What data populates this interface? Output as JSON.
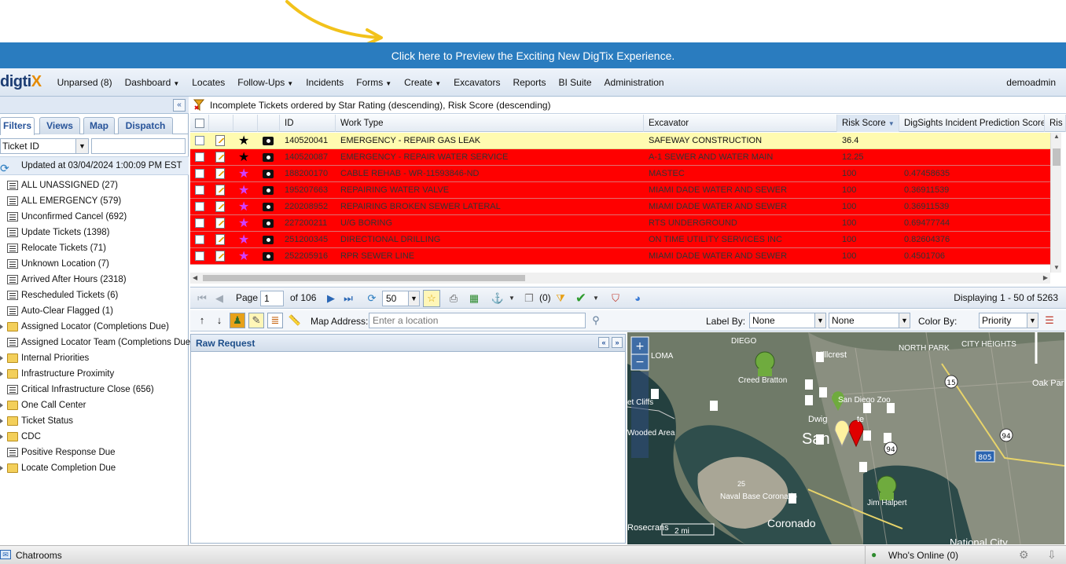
{
  "banner": {
    "text": "Click here to Preview the Exciting New DigTix Experience."
  },
  "nav": {
    "logo": "digtix",
    "items": [
      {
        "label": "Unparsed (8)",
        "caret": false
      },
      {
        "label": "Dashboard",
        "caret": true
      },
      {
        "label": "Locates",
        "caret": false
      },
      {
        "label": "Follow-Ups",
        "caret": true
      },
      {
        "label": "Incidents",
        "caret": false
      },
      {
        "label": "Forms",
        "caret": true
      },
      {
        "label": "Create",
        "caret": true
      },
      {
        "label": "Excavators",
        "caret": false
      },
      {
        "label": "Reports",
        "caret": false
      },
      {
        "label": "BI Suite",
        "caret": false
      },
      {
        "label": "Administration",
        "caret": false
      }
    ],
    "user": "demoadmin"
  },
  "sidebar": {
    "tabs": [
      "Filters",
      "Views",
      "Map",
      "Dispatch"
    ],
    "filter_select": "Ticket ID",
    "updated": "Updated at 03/04/2024 1:00:09 PM EST",
    "items": [
      {
        "label": "ALL UNASSIGNED (27)",
        "type": "list"
      },
      {
        "label": "ALL EMERGENCY (579)",
        "type": "list"
      },
      {
        "label": "Unconfirmed Cancel (692)",
        "type": "list"
      },
      {
        "label": "Update Tickets (1398)",
        "type": "list"
      },
      {
        "label": "Relocate Tickets (71)",
        "type": "list"
      },
      {
        "label": "Unknown Location (7)",
        "type": "list"
      },
      {
        "label": "Arrived After Hours (2318)",
        "type": "list"
      },
      {
        "label": "Rescheduled Tickets (6)",
        "type": "list"
      },
      {
        "label": "Auto-Clear Flagged (1)",
        "type": "list"
      },
      {
        "label": "Assigned Locator (Completions Due)",
        "type": "folder"
      },
      {
        "label": "Assigned Locator Team (Completions Due",
        "type": "list"
      },
      {
        "label": "Internal Priorities",
        "type": "folder"
      },
      {
        "label": "Infrastructure Proximity",
        "type": "folder"
      },
      {
        "label": "Critical Infrastructure Close (656)",
        "type": "list"
      },
      {
        "label": "One Call Center",
        "type": "folder"
      },
      {
        "label": "Ticket Status",
        "type": "folder"
      },
      {
        "label": "CDC",
        "type": "folder"
      },
      {
        "label": "Positive Response Due",
        "type": "list"
      },
      {
        "label": "Locate Completion Due",
        "type": "folder"
      }
    ]
  },
  "grid": {
    "title": "Incomplete Tickets ordered by Star Rating (descending), Risk Score (descending)",
    "columns": [
      "ID",
      "Work Type",
      "Excavator",
      "Risk Score",
      "DigSights Incident Prediction Score",
      "Ris"
    ],
    "rows": [
      {
        "id": "140520041",
        "work_type": "EMERGENCY - REPAIR GAS LEAK",
        "excavator": "SAFEWAY CONSTRUCTION",
        "risk": "36.4",
        "pred": "",
        "star": "black",
        "style": "sel"
      },
      {
        "id": "140520087",
        "work_type": "EMERGENCY - REPAIR WATER SERVICE",
        "excavator": "A-1 SEWER AND WATER MAIN",
        "risk": "12.25",
        "pred": "",
        "star": "black",
        "style": "hot"
      },
      {
        "id": "188200170",
        "work_type": "CABLE REHAB - WR-11593846-ND",
        "excavator": "MASTEC",
        "risk": "100",
        "pred": "0.47458635",
        "star": "magenta",
        "style": "hot"
      },
      {
        "id": "195207663",
        "work_type": "REPAIRING WATER VALVE",
        "excavator": "MIAMI DADE WATER AND SEWER",
        "risk": "100",
        "pred": "0.36911539",
        "star": "magenta",
        "style": "hot"
      },
      {
        "id": "220208952",
        "work_type": "REPAIRING BROKEN SEWER LATERAL",
        "excavator": "MIAMI DADE WATER AND SEWER",
        "risk": "100",
        "pred": "0.36911539",
        "star": "magenta",
        "style": "hot"
      },
      {
        "id": "227200211",
        "work_type": "U/G BORING",
        "excavator": "RTS UNDERGROUND",
        "risk": "100",
        "pred": "0.69477744",
        "star": "magenta",
        "style": "hot"
      },
      {
        "id": "251200345",
        "work_type": "DIRECTIONAL DRILLING",
        "excavator": "ON TIME UTILITY SERVICES INC",
        "risk": "100",
        "pred": "0.82604376",
        "star": "magenta",
        "style": "hot"
      },
      {
        "id": "252205916",
        "work_type": "RPR SEWER LINE",
        "excavator": "MIAMI DADE WATER AND SEWER",
        "risk": "100",
        "pred": "0.4501706",
        "star": "magenta",
        "style": "hot"
      }
    ]
  },
  "pager": {
    "page_label": "Page",
    "page_value": "1",
    "of_label": "of 106",
    "per_page": "50",
    "selected_count": "(0)",
    "displaying": "Displaying 1 - 50 of 5263"
  },
  "maptools": {
    "address_label": "Map Address:",
    "address_placeholder": "Enter a location",
    "label_by_label": "Label By:",
    "label_by_1": "None",
    "label_by_2": "None",
    "color_by_label": "Color By:",
    "color_by": "Priority"
  },
  "raw_request": {
    "title": "Raw Request"
  },
  "map": {
    "labels": [
      "Hillcrest",
      "NORTH PARK",
      "CITY HEIGHTS",
      "Oak Par",
      "San Diego Zoo",
      "Creed Bratton",
      "Dwig",
      "te",
      "San",
      "Wooded Area",
      "et Cliffs",
      "Naval Base Coronado",
      "Coronado",
      "Jim Halpert",
      "National City",
      "LOMA",
      "Rosecrans",
      "DIEGO",
      "2 mi",
      "N",
      "SAN DIEGO",
      "15",
      "94",
      "805",
      "25",
      "94"
    ],
    "scale": "2 mi"
  },
  "bottom": {
    "chatrooms": "Chatrooms",
    "whos_online": "Who's Online (0)"
  }
}
